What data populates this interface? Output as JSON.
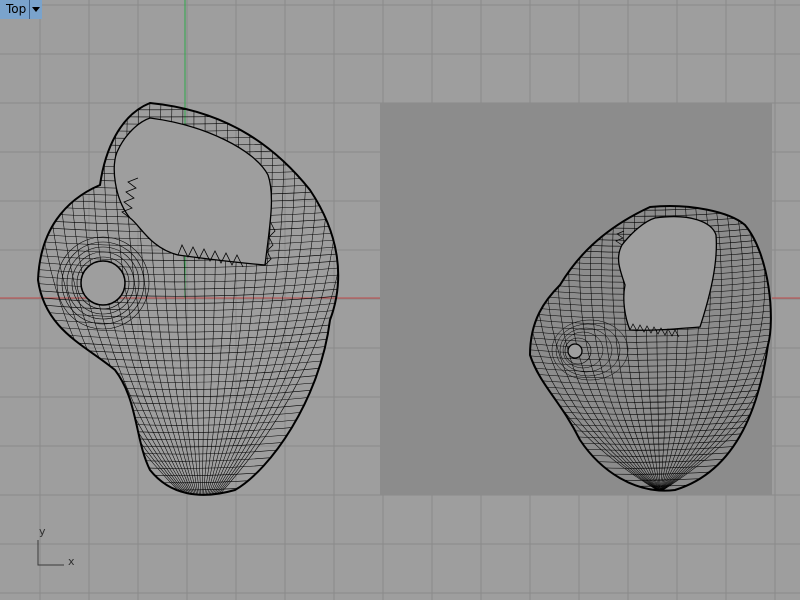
{
  "viewport": {
    "title": "Top",
    "menu_icon": "chevron-down-icon"
  },
  "axis_widget": {
    "x_label": "x",
    "y_label": "y"
  },
  "colors": {
    "background": "#9e9e9e",
    "grid_line": "#8a8a8a",
    "x_axis": "#c04a4a",
    "y_axis": "#2fa84a",
    "selection_region": "#8c8c8c",
    "wireframe": "#000000",
    "title_bg": "#7aa3cc"
  }
}
